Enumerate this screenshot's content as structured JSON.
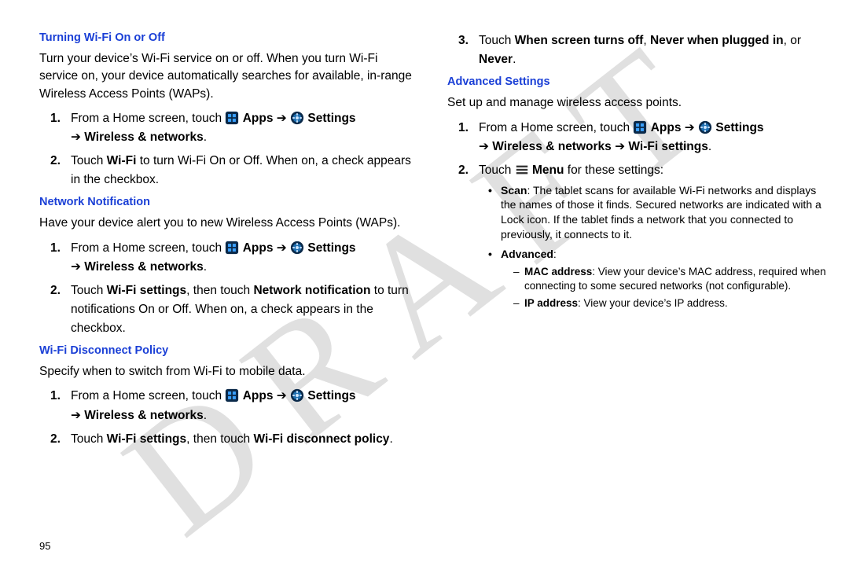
{
  "watermark": "DRAFT",
  "page_number": "95",
  "common": {
    "from_home": "From a Home screen, touch ",
    "apps_label": "Apps",
    "arrow": " ➔ ",
    "settings_label": "Settings",
    "arrow_line2": "➔ ",
    "wireless_networks": "Wireless & networks",
    "wifi_settings": "Wi-Fi settings",
    "menu_label": "Menu"
  },
  "left": {
    "sec1": {
      "heading": "Turning Wi-Fi On or Off",
      "intro": "Turn your device’s Wi-Fi service on or off. When you turn Wi-Fi service on, your device automatically searches for available, in-range Wireless Access Points (WAPs).",
      "step1_num": "1.",
      "step2_num": "2.",
      "step2_a": "Touch ",
      "step2_b": "Wi-Fi",
      "step2_c": " to turn Wi-Fi On or Off. When on, a check appears in the checkbox."
    },
    "sec2": {
      "heading": "Network Notification",
      "intro": "Have your device alert you to new Wireless Access Points (WAPs).",
      "step1_num": "1.",
      "step2_num": "2.",
      "step2_a": "Touch ",
      "step2_b": "Wi-Fi settings",
      "step2_c": ", then touch ",
      "step2_d": "Network notification",
      "step2_e": " to turn notifications On or Off. When on, a check appears in the checkbox."
    },
    "sec3": {
      "heading": "Wi-Fi Disconnect Policy",
      "intro": "Specify when to switch from Wi-Fi to mobile data.",
      "step1_num": "1.",
      "step2_num": "2.",
      "step2_a": "Touch ",
      "step2_b": "Wi-Fi settings",
      "step2_c": ", then touch ",
      "step2_d": "Wi-Fi disconnect policy",
      "step2_e": "."
    }
  },
  "right": {
    "cont": {
      "step3_num": "3.",
      "a": "Touch ",
      "b": "When screen turns off",
      "c": ", ",
      "d": "Never when plugged in",
      "e": ", or ",
      "f": "Never",
      "g": "."
    },
    "sec4": {
      "heading": "Advanced Settings",
      "intro": "Set up and manage wireless access points.",
      "step1_num": "1.",
      "step2_num": "2.",
      "step2_a": "Touch ",
      "step2_c": " for these settings:",
      "bullet1_a": "Scan",
      "bullet1_b": ": The tablet scans for available Wi-Fi networks and displays the names of those it finds. Secured networks are indicated with a Lock icon. If the tablet finds a network that you connected to previously, it connects to it.",
      "bullet2_a": "Advanced",
      "bullet2_b": ":",
      "dash1_a": "MAC address",
      "dash1_b": ": View your device’s MAC address, required when connecting to some secured networks (not configurable).",
      "dash2_a": "IP address",
      "dash2_b": ": View your device’s IP address."
    }
  }
}
